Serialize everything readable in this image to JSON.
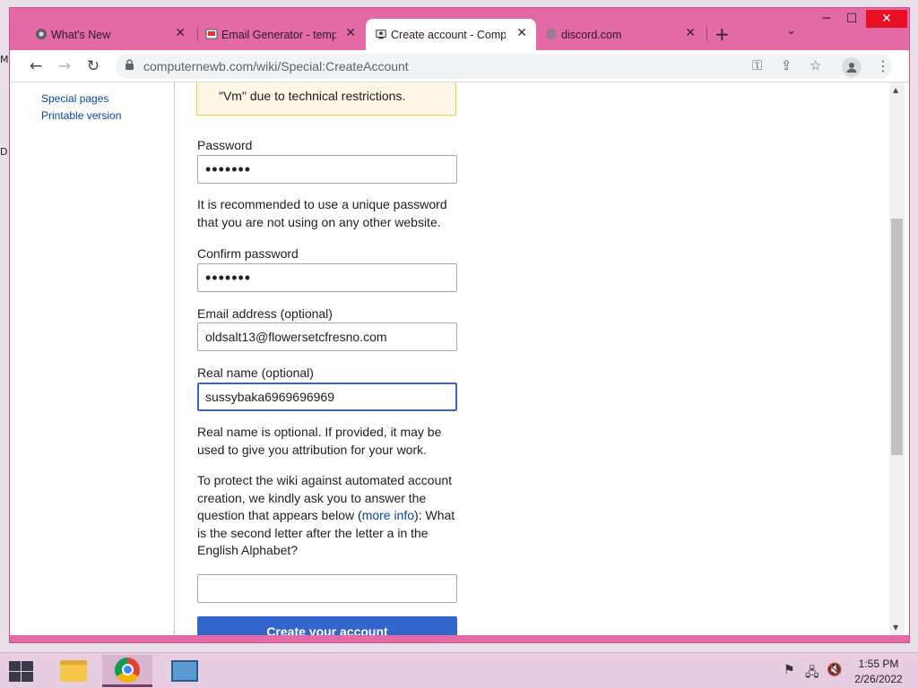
{
  "desktop": {
    "glyph_m": "M",
    "glyph_d": "D"
  },
  "window": {
    "controls": {
      "minimize": "─",
      "maximize": "☐",
      "close": "✕"
    }
  },
  "tabs": [
    {
      "title": "What's New",
      "icon": "chrome-icon",
      "active": false
    },
    {
      "title": "Email Generator - temp",
      "icon": "email-generator-icon",
      "active": false
    },
    {
      "title": "Create account - Comp",
      "icon": "wiki-icon",
      "active": true
    },
    {
      "title": "discord.com",
      "icon": "discord-icon",
      "active": false
    }
  ],
  "tab_close_glyph": "✕",
  "new_tab_glyph": "+",
  "tab_search_glyph": "⌄",
  "toolbar": {
    "back": "←",
    "forward": "→",
    "reload": "↻",
    "url": "computernewb.com/wiki/Special:CreateAccount",
    "lock": "🔒",
    "key_icon": "⚿",
    "share_icon": "⇪",
    "star_icon": "☆",
    "profile_icon": "👤",
    "menu_icon": "⋮"
  },
  "sidebar": {
    "links": [
      "Special pages",
      "Printable version"
    ]
  },
  "form": {
    "warning_text": "\"Vm\" due to technical restrictions.",
    "password_label": "Password",
    "password_value": "•••••••",
    "password_help": "It is recommended to use a unique password that you are not using on any other website.",
    "confirm_label": "Confirm password",
    "confirm_value": "•••••••",
    "email_label": "Email address (optional)",
    "email_value": "oldsalt13@flowersetcfresno.com",
    "realname_label": "Real name (optional)",
    "realname_value": "sussybaka6969696969",
    "realname_help": "Real name is optional. If provided, it may be used to give you attribution for your work.",
    "captcha_text_before": "To protect the wiki against automated account creation, we kindly ask you to answer the question that appears below (",
    "captcha_link": "more info",
    "captcha_text_after": "): What is the second letter after the letter a in the English Alphabet?",
    "captcha_value": "",
    "submit_label": "Create your account"
  },
  "scrollbar": {
    "up": "▲",
    "down": "▼"
  },
  "taskbar": {
    "tray": {
      "flag": "⚑",
      "network": "🖧",
      "volume": "🔇"
    },
    "time": "1:55 PM",
    "date": "2/26/2022"
  }
}
